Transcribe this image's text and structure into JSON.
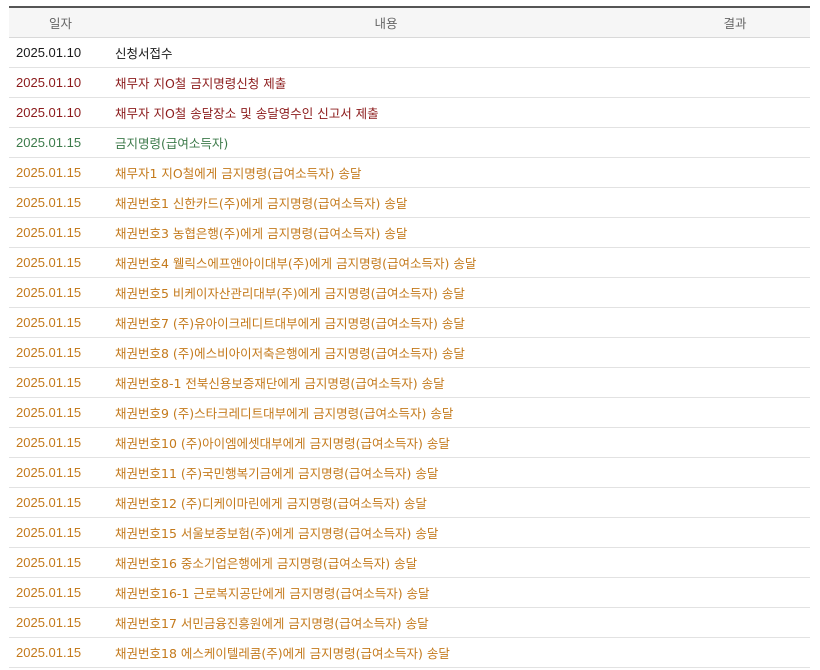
{
  "header": {
    "date": "일자",
    "content": "내용",
    "result": "결과"
  },
  "colors": {
    "black": "#1a1a1a",
    "maroon": "#8b1a1a",
    "green": "#3d7a4a",
    "orange": "#c47a1c"
  },
  "rows": [
    {
      "date": "2025.01.10",
      "content": "신청서접수",
      "result": "",
      "color": "black"
    },
    {
      "date": "2025.01.10",
      "content": "채무자 지O철 금지명령신청 제출",
      "result": "",
      "color": "maroon"
    },
    {
      "date": "2025.01.10",
      "content": "채무자 지O철 송달장소 및 송달영수인 신고서 제출",
      "result": "",
      "color": "maroon"
    },
    {
      "date": "2025.01.15",
      "content": "금지명령(급여소득자)",
      "result": "",
      "color": "green"
    },
    {
      "date": "2025.01.15",
      "content": "채무자1 지O철에게 금지명령(급여소득자) 송달",
      "result": "",
      "color": "orange"
    },
    {
      "date": "2025.01.15",
      "content": "채권번호1 신한카드(주)에게 금지명령(급여소득자) 송달",
      "result": "",
      "color": "orange"
    },
    {
      "date": "2025.01.15",
      "content": "채권번호3 농협은행(주)에게 금지명령(급여소득자) 송달",
      "result": "",
      "color": "orange"
    },
    {
      "date": "2025.01.15",
      "content": "채권번호4 웰릭스에프앤아이대부(주)에게 금지명령(급여소득자) 송달",
      "result": "",
      "color": "orange"
    },
    {
      "date": "2025.01.15",
      "content": "채권번호5 비케이자산관리대부(주)에게 금지명령(급여소득자) 송달",
      "result": "",
      "color": "orange"
    },
    {
      "date": "2025.01.15",
      "content": "채권번호7 (주)유아이크레디트대부에게 금지명령(급여소득자) 송달",
      "result": "",
      "color": "orange"
    },
    {
      "date": "2025.01.15",
      "content": "채권번호8 (주)에스비아이저축은행에게 금지명령(급여소득자) 송달",
      "result": "",
      "color": "orange"
    },
    {
      "date": "2025.01.15",
      "content": "채권번호8-1 전북신용보증재단에게 금지명령(급여소득자) 송달",
      "result": "",
      "color": "orange"
    },
    {
      "date": "2025.01.15",
      "content": "채권번호9 (주)스타크레디트대부에게 금지명령(급여소득자) 송달",
      "result": "",
      "color": "orange"
    },
    {
      "date": "2025.01.15",
      "content": "채권번호10 (주)아이엠에셋대부에게 금지명령(급여소득자) 송달",
      "result": "",
      "color": "orange"
    },
    {
      "date": "2025.01.15",
      "content": "채권번호11 (주)국민행복기금에게 금지명령(급여소득자) 송달",
      "result": "",
      "color": "orange"
    },
    {
      "date": "2025.01.15",
      "content": "채권번호12 (주)디케이마린에게 금지명령(급여소득자) 송달",
      "result": "",
      "color": "orange"
    },
    {
      "date": "2025.01.15",
      "content": "채권번호15 서울보증보험(주)에게 금지명령(급여소득자) 송달",
      "result": "",
      "color": "orange"
    },
    {
      "date": "2025.01.15",
      "content": "채권번호16 중소기업은행에게 금지명령(급여소득자) 송달",
      "result": "",
      "color": "orange"
    },
    {
      "date": "2025.01.15",
      "content": "채권번호16-1 근로복지공단에게 금지명령(급여소득자) 송달",
      "result": "",
      "color": "orange"
    },
    {
      "date": "2025.01.15",
      "content": "채권번호17 서민금융진흥원에게 금지명령(급여소득자) 송달",
      "result": "",
      "color": "orange"
    },
    {
      "date": "2025.01.15",
      "content": "채권번호18 에스케이텔레콤(주)에게 금지명령(급여소득자) 송달",
      "result": "",
      "color": "orange"
    }
  ]
}
